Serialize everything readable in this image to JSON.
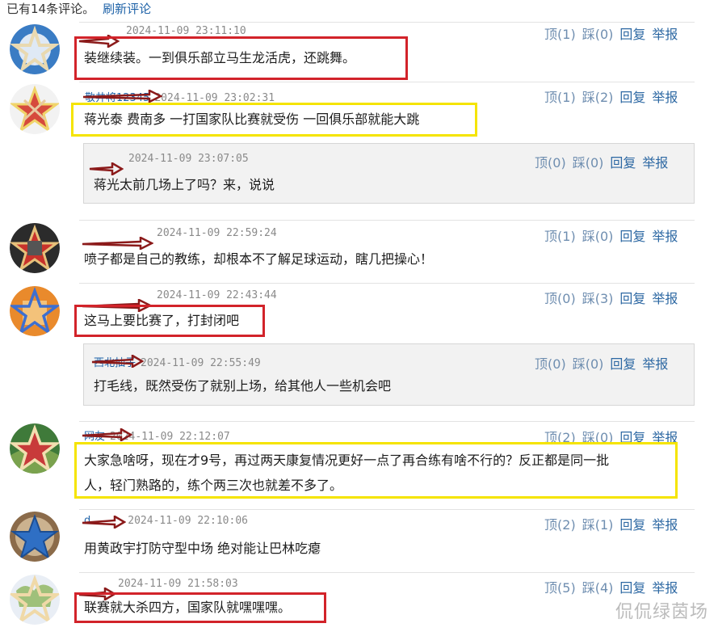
{
  "header": {
    "count_text": "已有14条评论。",
    "refresh_label": "刷新评论"
  },
  "action_labels": {
    "up": "顶",
    "down": "踩",
    "reply": "回复",
    "report": "举报"
  },
  "comments": [
    {
      "time": "2024-11-09 23:11:10",
      "up": "(1)",
      "down": "(0)",
      "lines": [
        "装继续装。一到俱乐部立马生龙活虎，还跳舞。"
      ],
      "highlight": "red"
    },
    {
      "user": "敬井将12345",
      "time": "2024-11-09 23:02:31",
      "up": "(1)",
      "down": "(2)",
      "lines": [
        "蒋光泰  费南多  一打国家队比赛就受伤  一回俱乐部就能大跳"
      ],
      "highlight": "yellow",
      "reply": {
        "time": "2024-11-09 23:07:05",
        "up": "(0)",
        "down": "(0)",
        "text": "蒋光太前几场上了吗？来，说说"
      }
    },
    {
      "time": "2024-11-09 22:59:24",
      "up": "(1)",
      "down": "(0)",
      "lines": [
        "喷子都是自己的教练，却根本不了解足球运动，瞎几把操心！"
      ],
      "highlight": ""
    },
    {
      "time": "2024-11-09 22:43:44",
      "up": "(0)",
      "down": "(3)",
      "lines": [
        "这马上要比赛了，打封闭吧"
      ],
      "highlight": "red",
      "reply": {
        "user": "西北抽子",
        "time": "2024-11-09 22:55:49",
        "up": "(0)",
        "down": "(0)",
        "text": "打毛线，既然受伤了就别上场，给其他人一些机会吧"
      }
    },
    {
      "user": "网友",
      "time": "2024-11-09 22:12:07",
      "up": "(2)",
      "down": "(0)",
      "lines": [
        "大家急啥呀，现在才9号，再过两天康复情况更好一点了再合练有啥不行的？反正都是同一批",
        "人，轻门熟路的，练个两三次也就差不多了。"
      ],
      "highlight": "yellow"
    },
    {
      "user": "d",
      "time": "2024-11-09 22:10:06",
      "up": "(2)",
      "down": "(1)",
      "lines": [
        "用黄政宇打防守型中场  绝对能让巴林吃瘪"
      ],
      "highlight": ""
    },
    {
      "time": "2024-11-09 21:58:03",
      "up": "(5)",
      "down": "(4)",
      "lines": [
        "联赛就大杀四方，国家队就嘿嘿嘿。"
      ],
      "highlight": "red"
    }
  ],
  "watermark": "侃侃绿茵场"
}
